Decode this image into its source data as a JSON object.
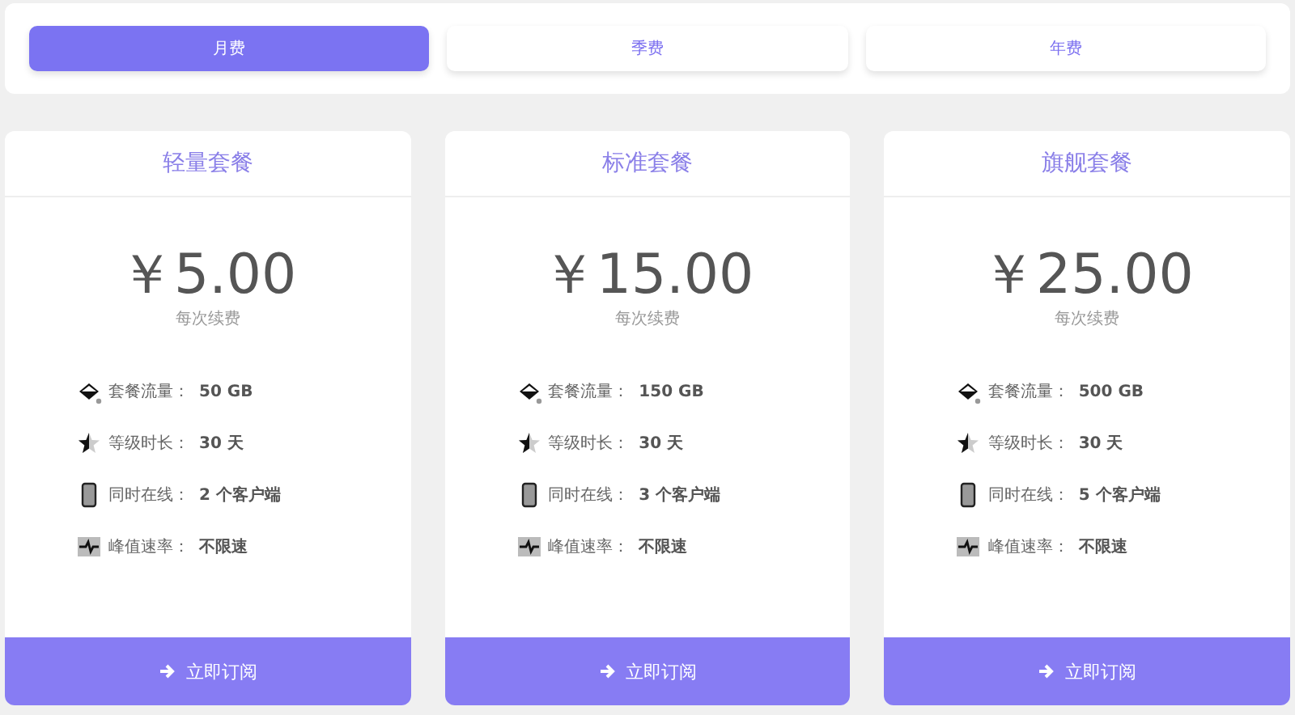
{
  "billing_tabs": [
    {
      "label": "月费",
      "selected": true
    },
    {
      "label": "季费",
      "selected": false
    },
    {
      "label": "年费",
      "selected": false
    }
  ],
  "plans": [
    {
      "name": "轻量套餐",
      "price": "￥5.00",
      "price_note": "每次续费",
      "features": [
        {
          "kind": "traffic",
          "label": "套餐流量：",
          "value": "50 GB"
        },
        {
          "kind": "level",
          "label": "等级时长：",
          "value": "30 天"
        },
        {
          "kind": "device",
          "label": "同时在线：",
          "value": "2 个客户端"
        },
        {
          "kind": "speed",
          "label": "峰值速率：",
          "value": "不限速"
        }
      ],
      "button": "立即订阅"
    },
    {
      "name": "标准套餐",
      "price": "￥15.00",
      "price_note": "每次续费",
      "features": [
        {
          "kind": "traffic",
          "label": "套餐流量：",
          "value": "150 GB"
        },
        {
          "kind": "level",
          "label": "等级时长：",
          "value": "30 天"
        },
        {
          "kind": "device",
          "label": "同时在线：",
          "value": "3 个客户端"
        },
        {
          "kind": "speed",
          "label": "峰值速率：",
          "value": "不限速"
        }
      ],
      "button": "立即订阅"
    },
    {
      "name": "旗舰套餐",
      "price": "￥25.00",
      "price_note": "每次续费",
      "features": [
        {
          "kind": "traffic",
          "label": "套餐流量：",
          "value": "500 GB"
        },
        {
          "kind": "level",
          "label": "等级时长：",
          "value": "30 天"
        },
        {
          "kind": "device",
          "label": "同时在线：",
          "value": "5 个客户端"
        },
        {
          "kind": "speed",
          "label": "峰值速率：",
          "value": "不限速"
        }
      ],
      "button": "立即订阅"
    }
  ]
}
